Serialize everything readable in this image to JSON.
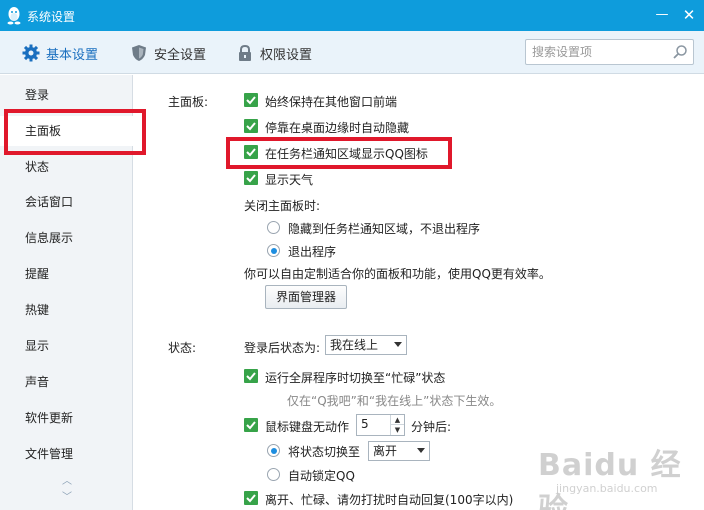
{
  "window": {
    "title": "系统设置",
    "minimize_symbol": "—",
    "close_symbol": "✕"
  },
  "tabs": [
    {
      "label": "基本设置",
      "icon": "gear-icon",
      "active": true
    },
    {
      "label": "安全设置",
      "icon": "shield-icon",
      "active": false
    },
    {
      "label": "权限设置",
      "icon": "lock-icon",
      "active": false
    }
  ],
  "search": {
    "placeholder": "搜索设置项",
    "value": ""
  },
  "sidebar": {
    "items": [
      {
        "label": "登录"
      },
      {
        "label": "主面板"
      },
      {
        "label": "状态"
      },
      {
        "label": "会话窗口"
      },
      {
        "label": "信息展示"
      },
      {
        "label": "提醒"
      },
      {
        "label": "热键"
      },
      {
        "label": "显示"
      },
      {
        "label": "声音"
      },
      {
        "label": "软件更新"
      },
      {
        "label": "文件管理"
      }
    ],
    "active_index": 1,
    "scroll_up": "︿",
    "scroll_down": "﹀"
  },
  "main_panel": {
    "section_label": "主面板:",
    "options": [
      {
        "label": "始终保持在其他窗口前端",
        "checked": true
      },
      {
        "label": "停靠在桌面边缘时自动隐藏",
        "checked": true
      },
      {
        "label": "在任务栏通知区域显示QQ图标",
        "checked": true
      },
      {
        "label": "显示天气",
        "checked": true
      }
    ],
    "close_label": "关闭主面板时:",
    "close_options": [
      {
        "label": "隐藏到任务栏通知区域，不退出程序",
        "selected": false
      },
      {
        "label": "退出程序",
        "selected": true
      }
    ],
    "custom_text": "你可以自由定制适合你的面板和功能，使用QQ更有效率。",
    "manager_button": "界面管理器"
  },
  "status": {
    "section_label": "状态:",
    "after_login_label": "登录后状态为:",
    "after_login_value": "我在线上",
    "fullscreen_label": "运行全屏程序时切换至“忙碌”状态",
    "fullscreen_checked": true,
    "fullscreen_note": "仅在“Q我吧”和“我在线上”状态下生效。",
    "idle_label": "鼠标键盘无动作",
    "idle_checked": true,
    "idle_minutes": "5",
    "idle_suffix": "分钟后:",
    "idle_options": [
      {
        "label": "将状态切换至",
        "selected": true
      },
      {
        "label": "自动锁定QQ",
        "selected": false
      }
    ],
    "idle_switch_value": "离开",
    "auto_reply_label": "离开、忙碌、请勿打扰时自动回复(100字以内)",
    "auto_reply_checked": true
  },
  "watermark": {
    "big": "Baidu 经验",
    "small": "jingyan.baidu.com"
  },
  "colors": {
    "titlebar": "#0e9cdc",
    "checkbox": "#37a349",
    "highlight": "#e0182b",
    "active_tab": "#1a6fbf"
  }
}
